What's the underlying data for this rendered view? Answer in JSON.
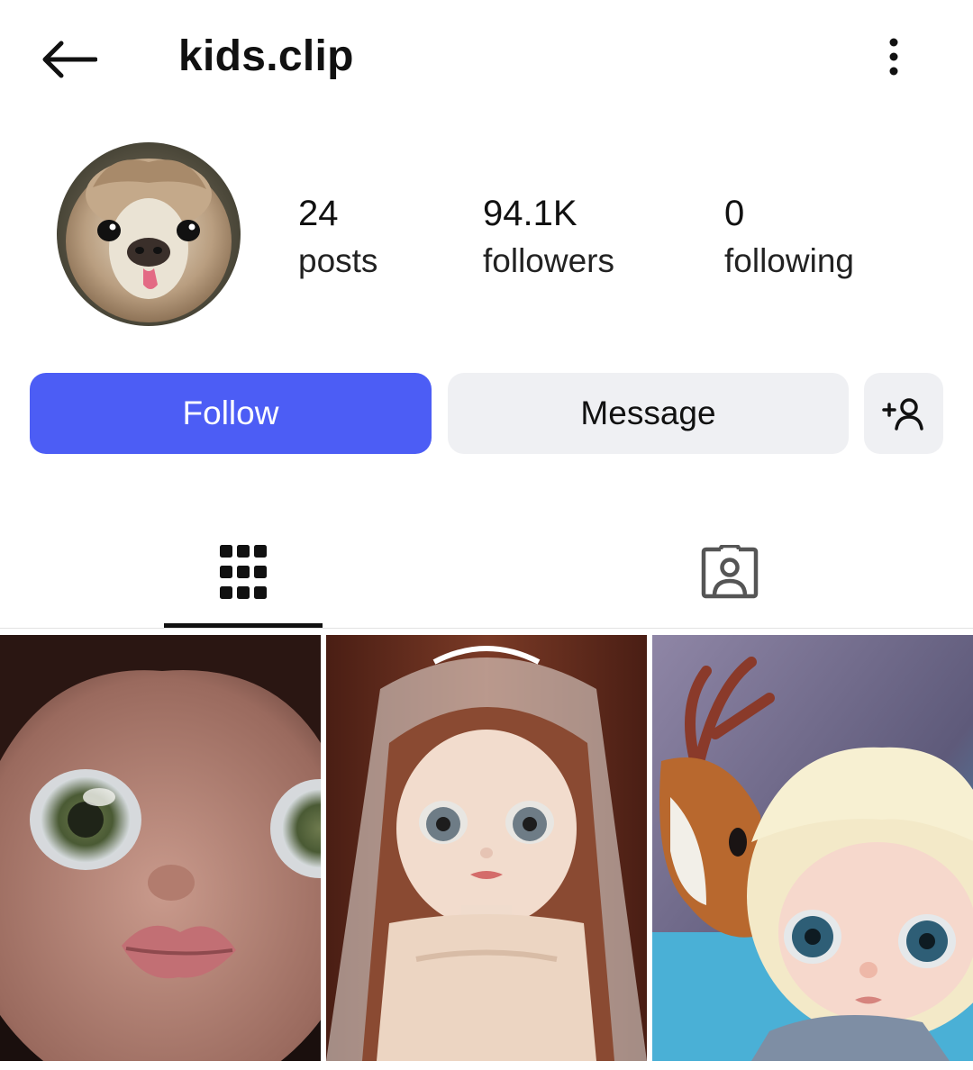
{
  "header": {
    "title": "kids.clip",
    "back_icon": "arrow-left-icon",
    "more_icon": "more-vertical-icon"
  },
  "profile": {
    "avatar_icon": "alpaca-avatar",
    "stats": [
      {
        "value": "24",
        "label": "posts"
      },
      {
        "value": "94.1K",
        "label": "followers"
      },
      {
        "value": "0",
        "label": "following"
      }
    ]
  },
  "actions": {
    "follow_label": "Follow",
    "message_label": "Message",
    "add_user_icon": "add-user-icon"
  },
  "tabs": [
    {
      "name": "posts-grid",
      "icon": "grid-icon",
      "selected": true
    },
    {
      "name": "tagged",
      "icon": "tagged-person-icon",
      "selected": false
    }
  ],
  "colors": {
    "accent": "#4c5df5",
    "secondary_button": "#eff0f3",
    "text": "#111111"
  },
  "posts": [
    {
      "icon": "doll-closeup-thumbnail"
    },
    {
      "icon": "bride-doll-thumbnail"
    },
    {
      "icon": "blonde-doll-with-deer-thumbnail"
    }
  ]
}
